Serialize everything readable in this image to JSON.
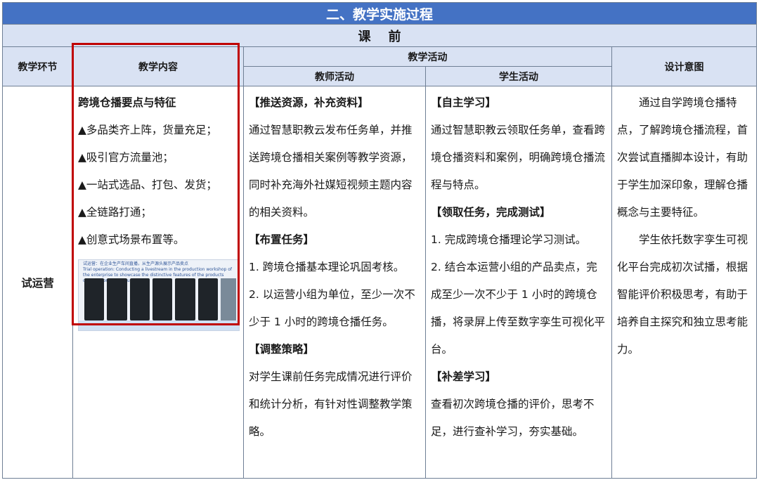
{
  "title": "二、教学实施过程",
  "phase": "课    前",
  "headers": {
    "stage": "教学环节",
    "content": "教学内容",
    "activities": "教学活动",
    "teacher": "教师活动",
    "student": "学生活动",
    "design": "设计意图"
  },
  "row": {
    "stage": "试运营",
    "content": {
      "heading": "跨境仓播要点与特征",
      "items": [
        "▲多品类齐上阵，货量充足；",
        "▲吸引官方流量池；",
        "▲一站式选品、打包、发货；",
        "▲全链路打通；",
        "▲创意式场景布置等。"
      ],
      "image_caption_cn": "试运营：在企业生产车间直播，从生产源头展示产品卖点",
      "image_caption_en": "Trial operation: Conducting a livestream in the production workshop of the enterprise to showcase the distinctive features of the products directly from their source."
    },
    "teacher": {
      "h1": "【推送资源，补充资料】",
      "p1": "通过智慧职教云发布任务单，并推送跨境仓播相关案例等教学资源，同时补充海外社媒短视频主题内容的相关资料。",
      "h2": "【布置任务】",
      "p2": "1. 跨境仓播基本理论巩固考核。",
      "p3": "2. 以运营小组为单位，至少一次不少于 1 小时的跨境仓播任务。",
      "h3": "【调整策略】",
      "p4": "对学生课前任务完成情况进行评价和统计分析，有针对性调整教学策略。"
    },
    "student": {
      "h1": "【自主学习】",
      "p1": "通过智慧职教云领取任务单，查看跨境仓播资料和案例，明确跨境仓播流程与特点。",
      "h2": "【领取任务，完成测试】",
      "p2": "1. 完成跨境仓播理论学习测试。",
      "p3": "2. 结合本运营小组的产品卖点，完成至少一次不少于 1 小时的跨境仓播，将录屏上传至数字孪生可视化平台。",
      "h3": "【补差学习】",
      "p4": "查看初次跨境仓播的评价，思考不足，进行查补学习，夯实基础。"
    },
    "design": {
      "p1": "通过自学跨境仓播特点，了解跨境仓播流程，首次尝试直播脚本设计，有助于学生加深印象，理解仓播概念与主要特征。",
      "p2": "学生依托数字孪生可视化平台完成初次试播，根据智能评价积极思考，有助于培养自主探究和独立思考能力。"
    }
  },
  "colors": {
    "title_bg": "#4472c4",
    "header_bg": "#d9e2f3",
    "highlight_frame": "#c00000"
  }
}
